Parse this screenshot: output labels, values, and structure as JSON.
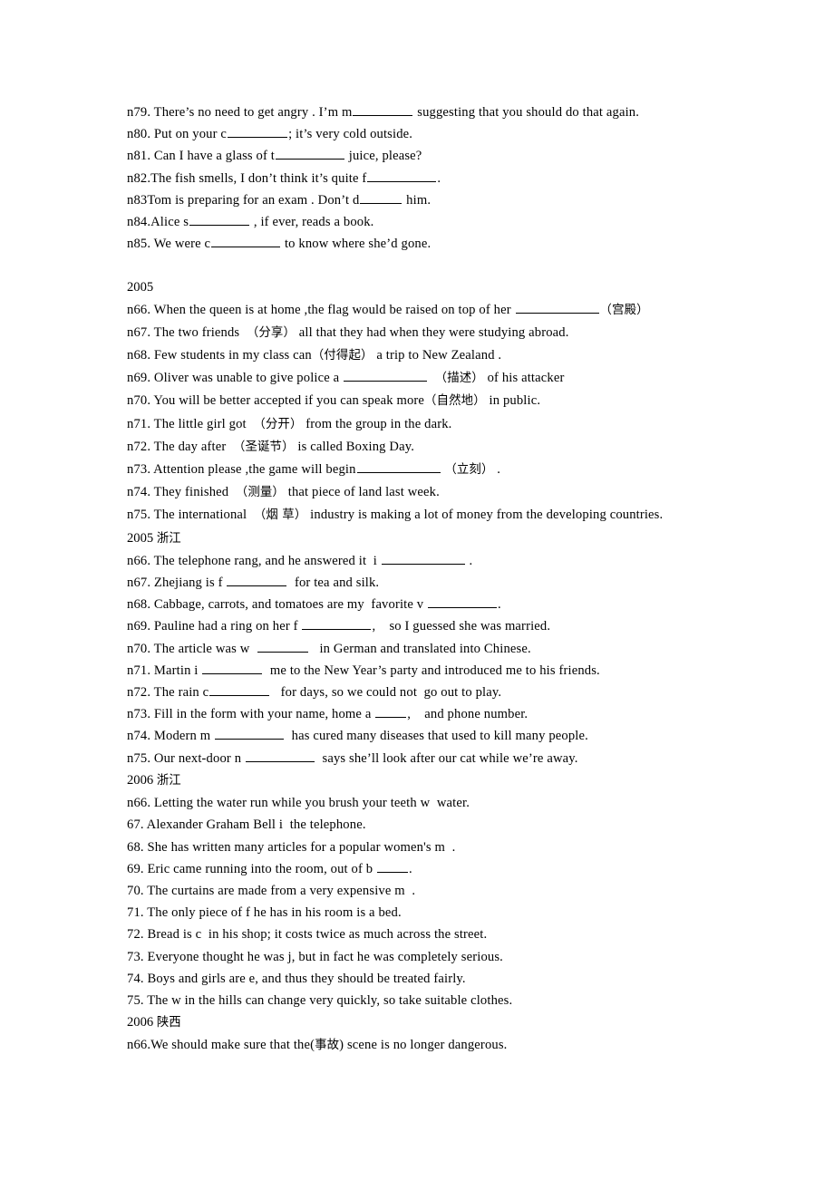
{
  "document": {
    "font_color": "#000000",
    "background": "#ffffff",
    "blocks": [
      {
        "id": "block-2004-tail",
        "type": "questions",
        "lines": [
          {
            "id": "n79",
            "segments": [
              {
                "t": "text",
                "v": "n79. There’s no need to get angry . I’m m"
              },
              {
                "t": "blank",
                "size": "b-l"
              },
              {
                "t": "text",
                "v": " suggesting that you should do that again."
              }
            ]
          },
          {
            "id": "n80",
            "segments": [
              {
                "t": "text",
                "v": "n80. Put on your c"
              },
              {
                "t": "blank",
                "size": "b-l"
              },
              {
                "t": "text",
                "v": "; it’s very cold outside."
              }
            ]
          },
          {
            "id": "n81",
            "segments": [
              {
                "t": "text",
                "v": "n81. Can I have a glass of t"
              },
              {
                "t": "blank",
                "size": "b-xl"
              },
              {
                "t": "text",
                "v": " juice, please?"
              }
            ]
          },
          {
            "id": "n82",
            "segments": [
              {
                "t": "text",
                "v": "n82.The fish smells, I don’t think it’s quite f"
              },
              {
                "t": "blank",
                "size": "b-xl"
              },
              {
                "t": "text",
                "v": "."
              }
            ]
          },
          {
            "id": "n83",
            "segments": [
              {
                "t": "text",
                "v": "n83Tom is preparing for an exam . Don’t d"
              },
              {
                "t": "blank",
                "size": "b-s"
              },
              {
                "t": "text",
                "v": " him."
              }
            ]
          },
          {
            "id": "n84",
            "segments": [
              {
                "t": "text",
                "v": "n84.Alice s"
              },
              {
                "t": "blank",
                "size": "b-l"
              },
              {
                "t": "text",
                "v": " , if ever, reads a book."
              }
            ]
          },
          {
            "id": "n85",
            "segments": [
              {
                "t": "text",
                "v": "n85. We were c"
              },
              {
                "t": "blank",
                "size": "b-xl"
              },
              {
                "t": "text",
                "v": " to know where she’d gone."
              }
            ]
          }
        ]
      },
      {
        "id": "spacer-1",
        "type": "spacer"
      },
      {
        "id": "block-2005",
        "type": "section",
        "heading": "2005",
        "lines": [
          {
            "id": "2005-n66",
            "segments": [
              {
                "t": "text",
                "v": "n66. When the queen is at home ,the flag would be raised on top of her "
              },
              {
                "t": "blank",
                "size": "b-xxl"
              },
              {
                "t": "cjk",
                "v": "（宫殿）"
              }
            ]
          },
          {
            "id": "2005-n67",
            "segments": [
              {
                "t": "text",
                "v": "n67. The two friends  "
              },
              {
                "t": "cjk",
                "v": "（分享）"
              },
              {
                "t": "text",
                "v": " all that they had when they were studying abroad."
              }
            ]
          },
          {
            "id": "2005-n68",
            "segments": [
              {
                "t": "text",
                "v": "n68. Few students in my class can"
              },
              {
                "t": "cjk",
                "v": "（付得起）"
              },
              {
                "t": "text",
                "v": " a trip to New Zealand ."
              }
            ]
          },
          {
            "id": "2005-n69",
            "segments": [
              {
                "t": "text",
                "v": "n69. Oliver was unable to give police a "
              },
              {
                "t": "blank",
                "size": "b-xxl"
              },
              {
                "t": "text",
                "v": "  "
              },
              {
                "t": "cjk",
                "v": "（描述）"
              },
              {
                "t": "text",
                "v": " of his attacker"
              }
            ]
          },
          {
            "id": "2005-n70",
            "segments": [
              {
                "t": "text",
                "v": "n70. You will be better accepted if you can speak more"
              },
              {
                "t": "cjk",
                "v": "（自然地）"
              },
              {
                "t": "text",
                "v": " in public."
              }
            ]
          },
          {
            "id": "2005-n71",
            "segments": [
              {
                "t": "text",
                "v": "n71. The little girl got  "
              },
              {
                "t": "cjk",
                "v": "（分开）"
              },
              {
                "t": "text",
                "v": " from the group in the dark."
              }
            ]
          },
          {
            "id": "2005-n72",
            "segments": [
              {
                "t": "text",
                "v": "n72. The day after  "
              },
              {
                "t": "cjk",
                "v": "（圣诞节）"
              },
              {
                "t": "text",
                "v": " is called Boxing Day."
              }
            ]
          },
          {
            "id": "2005-n73",
            "segments": [
              {
                "t": "text",
                "v": "n73. Attention please ,the game will begin"
              },
              {
                "t": "blank",
                "size": "b-xxl"
              },
              {
                "t": "text",
                "v": " "
              },
              {
                "t": "cjk",
                "v": "（立刻）"
              },
              {
                "t": "text",
                "v": " ."
              }
            ]
          },
          {
            "id": "2005-n74",
            "segments": [
              {
                "t": "text",
                "v": "n74. They finished  "
              },
              {
                "t": "cjk",
                "v": "（测量）"
              },
              {
                "t": "text",
                "v": " that piece of land last week."
              }
            ]
          },
          {
            "id": "2005-n75",
            "justify": true,
            "segments": [
              {
                "t": "text",
                "v": "n75. The international  "
              },
              {
                "t": "cjk",
                "v": "（烟 草）"
              },
              {
                "t": "text",
                "v": " industry is making a lot of money from the developing countries."
              }
            ]
          }
        ]
      },
      {
        "id": "block-2005-zhejiang",
        "type": "section",
        "heading": "2005 浙江",
        "lines": [
          {
            "id": "zj2005-n66",
            "segments": [
              {
                "t": "text",
                "v": "n66. The telephone rang, and he answered it  i "
              },
              {
                "t": "blank",
                "size": "b-xxl"
              },
              {
                "t": "text",
                "v": " ."
              }
            ]
          },
          {
            "id": "zj2005-n67",
            "segments": [
              {
                "t": "text",
                "v": "n67. Zhejiang is f "
              },
              {
                "t": "blank",
                "size": "b-l"
              },
              {
                "t": "text",
                "v": "  for tea and silk."
              }
            ]
          },
          {
            "id": "zj2005-n68",
            "segments": [
              {
                "t": "text",
                "v": "n68. Cabbage, carrots, and tomatoes are my  favorite v "
              },
              {
                "t": "blank",
                "size": "b-xl"
              },
              {
                "t": "text",
                "v": "."
              }
            ]
          },
          {
            "id": "zj2005-n69",
            "segments": [
              {
                "t": "text",
                "v": "n69. Pauline had a ring on her f "
              },
              {
                "t": "blank",
                "size": "b-xl"
              },
              {
                "t": "text",
                "v": ",    so I guessed she was married."
              }
            ]
          },
          {
            "id": "zj2005-n70",
            "segments": [
              {
                "t": "text",
                "v": "n70. The article was w  "
              },
              {
                "t": "blank",
                "size": "b-m"
              },
              {
                "t": "text",
                "v": "   in German and translated into Chinese."
              }
            ]
          },
          {
            "id": "zj2005-n71",
            "segments": [
              {
                "t": "text",
                "v": "n71. Martin i "
              },
              {
                "t": "blank",
                "size": "b-l"
              },
              {
                "t": "text",
                "v": "  me to the New Year’s party and introduced me to his friends."
              }
            ]
          },
          {
            "id": "zj2005-n72",
            "segments": [
              {
                "t": "text",
                "v": "n72. The rain c"
              },
              {
                "t": "blank",
                "size": "b-l"
              },
              {
                "t": "text",
                "v": "   for days, so we could not  go out to play."
              }
            ]
          },
          {
            "id": "zj2005-n73",
            "segments": [
              {
                "t": "text",
                "v": "n73. Fill in the form with your name, home a "
              },
              {
                "t": "blank",
                "size": "b-xs"
              },
              {
                "t": "text",
                "v": ",    and phone number."
              }
            ]
          },
          {
            "id": "zj2005-n74",
            "segments": [
              {
                "t": "text",
                "v": "n74. Modern m "
              },
              {
                "t": "blank",
                "size": "b-xl"
              },
              {
                "t": "text",
                "v": "  has cured many diseases that used to kill many people."
              }
            ]
          },
          {
            "id": "zj2005-n75",
            "segments": [
              {
                "t": "text",
                "v": "n75. Our next-door n "
              },
              {
                "t": "blank",
                "size": "b-xl"
              },
              {
                "t": "text",
                "v": "  says she’ll look after our cat while we’re away."
              }
            ]
          }
        ]
      },
      {
        "id": "block-2006-zhejiang",
        "type": "section",
        "heading": "2006 浙江",
        "lines": [
          {
            "id": "zj2006-n66",
            "segments": [
              {
                "t": "text",
                "v": "n66. Letting the water run while you brush your teeth w  water."
              }
            ]
          },
          {
            "id": "zj2006-67",
            "segments": [
              {
                "t": "text",
                "v": "67. Alexander Graham Bell i  the telephone."
              }
            ]
          },
          {
            "id": "zj2006-68",
            "segments": [
              {
                "t": "text",
                "v": "68. She has written many articles for a popular women's m  ."
              }
            ]
          },
          {
            "id": "zj2006-69",
            "segments": [
              {
                "t": "text",
                "v": "69. Eric came running into the room, out of b "
              },
              {
                "t": "blank",
                "size": "b-xs"
              },
              {
                "t": "text",
                "v": "."
              }
            ]
          },
          {
            "id": "zj2006-70",
            "segments": [
              {
                "t": "text",
                "v": "70. The curtains are made from a very expensive m  ."
              }
            ]
          },
          {
            "id": "zj2006-71",
            "segments": [
              {
                "t": "text",
                "v": "71. The only piece of f he has in his room is a bed."
              }
            ]
          },
          {
            "id": "zj2006-72",
            "segments": [
              {
                "t": "text",
                "v": "72. Bread is c  in his shop; it costs twice as much across the street."
              }
            ]
          },
          {
            "id": "zj2006-73",
            "segments": [
              {
                "t": "text",
                "v": "73. Everyone thought he was j, but in fact he was completely serious."
              }
            ]
          },
          {
            "id": "zj2006-74",
            "segments": [
              {
                "t": "text",
                "v": "74. Boys and girls are e, and thus they should be treated fairly."
              }
            ]
          },
          {
            "id": "zj2006-75",
            "segments": [
              {
                "t": "text",
                "v": "75. The w in the hills can change very quickly, so take suitable clothes."
              }
            ]
          }
        ]
      },
      {
        "id": "block-2006-shaanxi",
        "type": "section",
        "heading": "2006 陕西",
        "lines": [
          {
            "id": "sx2006-n66",
            "segments": [
              {
                "t": "text",
                "v": "n66.We should make sure that the("
              },
              {
                "t": "cjk",
                "v": "事故"
              },
              {
                "t": "text",
                "v": ") scene is no longer dangerous."
              }
            ]
          }
        ]
      }
    ]
  }
}
